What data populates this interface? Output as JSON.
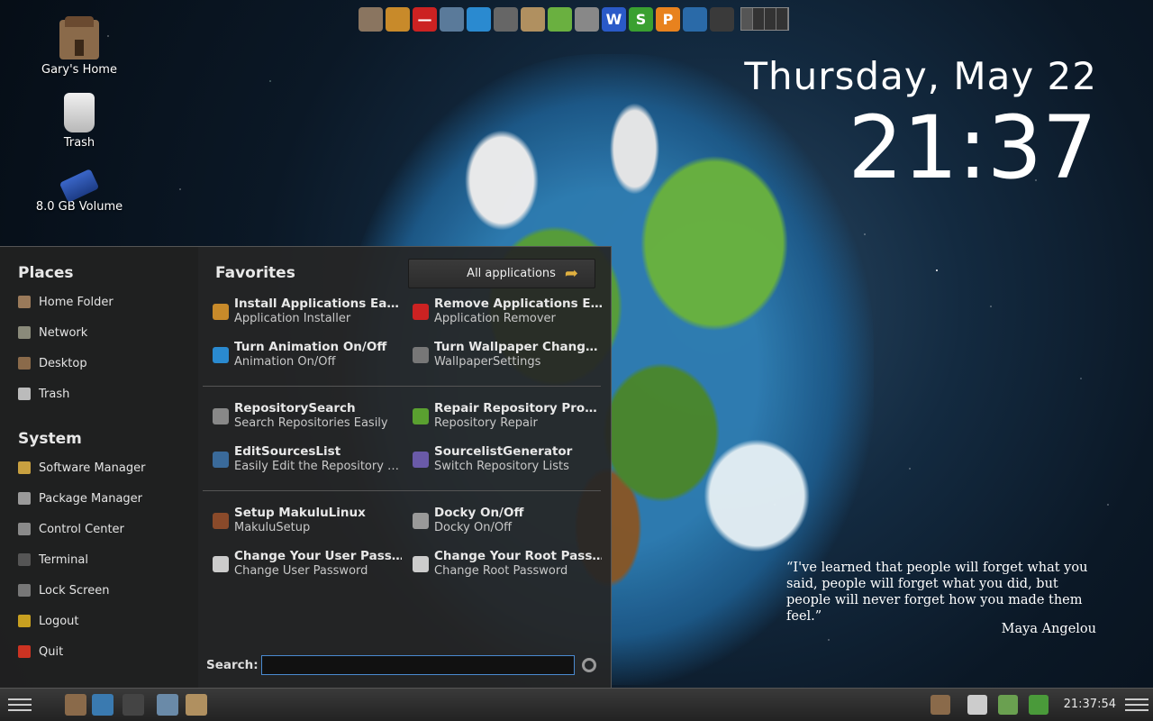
{
  "desktop": {
    "icons": [
      {
        "label": "Gary's Home",
        "icon": "home-folder-icon"
      },
      {
        "label": "Trash",
        "icon": "trash-icon"
      },
      {
        "label": "8.0 GB Volume",
        "icon": "usb-drive-icon"
      }
    ]
  },
  "top_launcher": {
    "items": [
      {
        "name": "home-launcher",
        "color": "#8a7560",
        "glyph": ""
      },
      {
        "name": "installer-launcher",
        "color": "#c88a2a",
        "glyph": ""
      },
      {
        "name": "remover-launcher",
        "color": "#cc2222",
        "glyph": "—"
      },
      {
        "name": "search-launcher",
        "color": "#5a7a9a",
        "glyph": ""
      },
      {
        "name": "animation-launcher",
        "color": "#2a8ad0",
        "glyph": ""
      },
      {
        "name": "wallpaper-launcher",
        "color": "#666666",
        "glyph": ""
      },
      {
        "name": "archive-launcher",
        "color": "#b09060",
        "glyph": ""
      },
      {
        "name": "leaf-launcher",
        "color": "#6ab040",
        "glyph": ""
      },
      {
        "name": "pen-launcher",
        "color": "#888888",
        "glyph": ""
      },
      {
        "name": "writer-launcher",
        "color": "#2a5ac8",
        "glyph": "W"
      },
      {
        "name": "spreadsheet-launcher",
        "color": "#3aa030",
        "glyph": "S"
      },
      {
        "name": "presentation-launcher",
        "color": "#e8821e",
        "glyph": "P"
      },
      {
        "name": "browser-launcher",
        "color": "#2a6aa8",
        "glyph": ""
      },
      {
        "name": "steam-launcher",
        "color": "#3a3a3a",
        "glyph": ""
      }
    ]
  },
  "clock": {
    "date": "Thursday, May 22",
    "time": "21:37"
  },
  "quote": {
    "text": "“I've learned that people will forget what you said, people will forget what you did, but people will never forget how you made them feel.”",
    "author": "Maya Angelou"
  },
  "menu": {
    "places_title": "Places",
    "places": [
      {
        "label": "Home Folder",
        "color": "#9a7a5a"
      },
      {
        "label": "Network",
        "color": "#8a8a7a"
      },
      {
        "label": "Desktop",
        "color": "#8a6a4a"
      },
      {
        "label": "Trash",
        "color": "#bbbbbb"
      }
    ],
    "system_title": "System",
    "system": [
      {
        "label": "Software Manager",
        "color": "#c8a040"
      },
      {
        "label": "Package Manager",
        "color": "#9a9a9a"
      },
      {
        "label": "Control Center",
        "color": "#8a8a8a"
      },
      {
        "label": "Terminal",
        "color": "#555555"
      },
      {
        "label": "Lock Screen",
        "color": "#777777"
      },
      {
        "label": "Logout",
        "color": "#c8a020"
      },
      {
        "label": "Quit",
        "color": "#cc3322"
      }
    ],
    "favorites_title": "Favorites",
    "all_apps_label": "All applications",
    "favorites": [
      {
        "name": "Install Applications Easily",
        "desc": "Application Installer",
        "color": "#c88a2a"
      },
      {
        "name": "Remove Applications Easily",
        "desc": "Application Remover",
        "color": "#cc2222"
      },
      {
        "name": "Turn Animation On/Off",
        "desc": "Animation On/Off",
        "color": "#2a8ad0"
      },
      {
        "name": "Turn Wallpaper Changer On/Off",
        "desc": "WallpaperSettings",
        "color": "#777777"
      },
      {
        "name": "RepositorySearch",
        "desc": "Search Repositories Easily",
        "color": "#888888"
      },
      {
        "name": "Repair Repository Problems",
        "desc": "Repository Repair",
        "color": "#5aa030"
      },
      {
        "name": "EditSourcesList",
        "desc": "Easily Edit the Repository Sources",
        "color": "#3a6a9a"
      },
      {
        "name": "SourcelistGenerator",
        "desc": "Switch Repository Lists",
        "color": "#6a5aa8"
      },
      {
        "name": "Setup MakuluLinux",
        "desc": "MakuluSetup",
        "color": "#8a4a2a"
      },
      {
        "name": "Docky On/Off",
        "desc": "Docky On/Off",
        "color": "#999999"
      },
      {
        "name": "Change Your User Password",
        "desc": "Change User Password",
        "color": "#cccccc"
      },
      {
        "name": "Change Your Root Password",
        "desc": "Change Root Password",
        "color": "#cccccc"
      }
    ],
    "search_label": "Search:",
    "search_value": ""
  },
  "panel": {
    "task_icons": [
      {
        "name": "home-task-icon",
        "color": "#8a6a4a"
      },
      {
        "name": "refresh-task-icon",
        "color": "#3a7ab0"
      },
      {
        "name": "terminal-task-icon",
        "color": "#444444"
      },
      {
        "name": "network-task-icon",
        "color": "#6a8aa8"
      },
      {
        "name": "archive-task-icon",
        "color": "#b09060"
      }
    ],
    "tray_icons": [
      {
        "name": "phone-tray-icon",
        "color": "#8a6a4a"
      },
      {
        "name": "display-tray-icon",
        "color": "#cccccc"
      },
      {
        "name": "signal-tray-icon",
        "color": "#6aa050"
      },
      {
        "name": "update-tray-icon",
        "color": "#4a9a3a"
      }
    ],
    "time": "21:37:54"
  }
}
